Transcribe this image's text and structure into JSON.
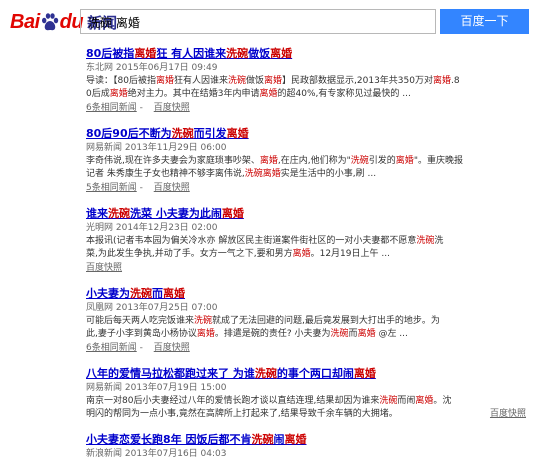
{
  "header": {
    "logo_bai": "Bai",
    "logo_du": "du",
    "logo_news": "新闻",
    "search_value": "洗碗 离婚",
    "search_button": "百度一下"
  },
  "results": [
    {
      "title_parts": [
        [
          "80后",
          "k"
        ],
        [
          "被指",
          "h"
        ],
        [
          "离婚",
          "e"
        ],
        [
          "狂 有人因谁来",
          "k"
        ],
        [
          "洗碗",
          "e"
        ],
        [
          "做饭",
          "k"
        ],
        [
          "离婚",
          "e"
        ]
      ],
      "source": "东北网  2015年06月17日 09:49",
      "snippet_lines": [
        [
          [
            "导读：【80后被指",
            "t"
          ],
          [
            "离婚",
            "e"
          ],
          [
            "狂有人因谁来",
            "t"
          ],
          [
            "洗碗",
            "e"
          ],
          [
            "做饭",
            "t"
          ],
          [
            "离婚",
            "e"
          ],
          [
            "】民政部数据显示,2013年共350万对",
            "t"
          ],
          [
            "离婚",
            "e"
          ],
          [
            ".8",
            "t"
          ]
        ],
        [
          [
            "0后成",
            "t"
          ],
          [
            "离婚",
            "e"
          ],
          [
            "绝对主力。其中在结婚3年内申请",
            "t"
          ],
          [
            "离婚",
            "e"
          ],
          [
            "的超40%,有专家称见过最快的 ...",
            "t"
          ]
        ]
      ],
      "same_news": "6条相同新闻",
      "cache": "百度快照",
      "links_inline": false
    },
    {
      "title_parts": [
        [
          "80后90后不断",
          "k"
        ],
        [
          "为",
          "k"
        ],
        [
          "洗碗",
          "e"
        ],
        [
          "而引发",
          "k"
        ],
        [
          "离婚",
          "e"
        ]
      ],
      "source": "网易新闻  2013年11月29日 06:00",
      "snippet_lines": [
        [
          [
            "李奇伟说,现在许多夫妻会为家庭琐事吵架、",
            "t"
          ],
          [
            "离婚",
            "e"
          ],
          [
            ",在庄内,他们称为\"",
            "t"
          ],
          [
            "洗碗",
            "e"
          ],
          [
            "引发的",
            "t"
          ],
          [
            "离婚",
            "e"
          ],
          [
            "\"。重庆晚报",
            "t"
          ]
        ],
        [
          [
            "记者 朱秀康生子女也精神不够李离伟说,",
            "t"
          ],
          [
            "洗碗",
            "e"
          ],
          [
            "离婚",
            "e"
          ],
          [
            "实是生活中的小事,刷 ...",
            "t"
          ]
        ]
      ],
      "same_news": "5条相同新闻",
      "cache": "百度快照",
      "links_inline": false
    },
    {
      "title_parts": [
        [
          "谁来",
          "k"
        ],
        [
          "洗碗",
          "e"
        ],
        [
          "洗菜 小夫妻为此闹",
          "k"
        ],
        [
          "离婚",
          "e"
        ]
      ],
      "source": "光明网  2014年12月23日 02:00",
      "snippet_lines": [
        [
          [
            "本报讯(记者韦本园为偏关冷水亦 解放区民主街道案件街社区的一对小夫妻都不愿意",
            "t"
          ],
          [
            "洗碗",
            "e"
          ],
          [
            "洗",
            "t"
          ]
        ],
        [
          [
            "菜,为此发生争执,并动了手。女方一气之下,要和男方",
            "t"
          ],
          [
            "离婚",
            "e"
          ],
          [
            "。12月19日上午 ...",
            "t"
          ]
        ]
      ],
      "same_news": "",
      "cache": "百度快照",
      "links_inline": false
    },
    {
      "title_parts": [
        [
          "小夫妻为",
          "k"
        ],
        [
          "洗碗",
          "e"
        ],
        [
          "而",
          "k"
        ],
        [
          "离婚",
          "e"
        ]
      ],
      "source": "凤凰网  2013年07月25日 07:00",
      "snippet_lines": [
        [
          [
            "可能后每天两人吃完饭谁来",
            "t"
          ],
          [
            "洗碗",
            "e"
          ],
          [
            "就成了无法回避的问题,最后竟发展到大打出手的地步。为",
            "t"
          ]
        ],
        [
          [
            "此,妻子小李到黄岛小杨协议",
            "t"
          ],
          [
            "离婚",
            "e"
          ],
          [
            "。排遣是碗的责任? 小夫妻为",
            "t"
          ],
          [
            "洗碗",
            "e"
          ],
          [
            "而",
            "t"
          ],
          [
            "离婚",
            "e"
          ],
          [
            " @左 ...",
            "t"
          ]
        ]
      ],
      "same_news": "6条相同新闻",
      "cache": "百度快照",
      "links_inline": false
    },
    {
      "title_parts": [
        [
          "八年的爱情马拉松都跑过来了 为谁",
          "k"
        ],
        [
          "洗碗",
          "e"
        ],
        [
          "的事个两口却闹",
          "k"
        ],
        [
          "离婚",
          "e"
        ]
      ],
      "source": "网易新闻  2013年07月19日 15:00",
      "snippet_lines": [
        [
          [
            "南京一对80后小夫妻经过八年的爱情长跑才谈以直结连理,结果却因为谁来",
            "t"
          ],
          [
            "洗碗",
            "e"
          ],
          [
            "而闹",
            "t"
          ],
          [
            "离婚",
            "e"
          ],
          [
            "。沈",
            "t"
          ]
        ],
        [
          [
            "明闪的帮同为一点小事,竟然在高牌所上打起来了,结果导致千余车辆的大拥堵。",
            "t"
          ]
        ]
      ],
      "same_news": "",
      "cache": "百度快照",
      "links_inline": true
    },
    {
      "title_parts": [
        [
          "小夫妻恋爱长跑8年 因饭后都不肯",
          "k"
        ],
        [
          "洗碗",
          "e"
        ],
        [
          "闹",
          "k"
        ],
        [
          "离婚",
          "e"
        ]
      ],
      "source": "新浪新闻  2013年07月16日 04:03",
      "snippet_lines": [],
      "same_news": "",
      "cache": "",
      "links_inline": false
    }
  ]
}
